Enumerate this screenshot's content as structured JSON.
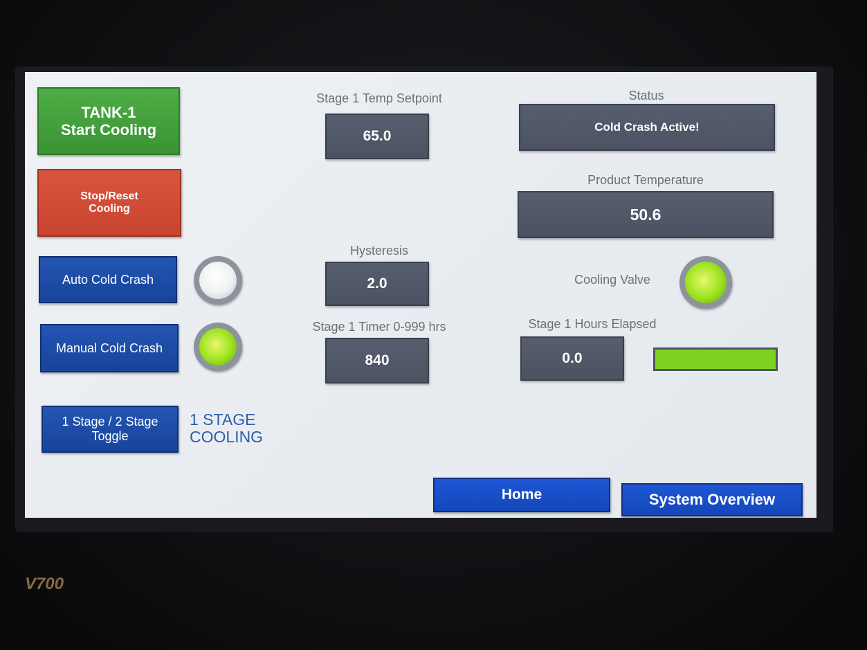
{
  "device": {
    "model": "V700"
  },
  "left_controls": {
    "start_button": "TANK-1\nStart Cooling",
    "stop_button": "Stop/Reset\nCooling",
    "auto_button": "Auto Cold Crash",
    "manual_button": "Manual Cold Crash",
    "stage_toggle_button": "1 Stage / 2 Stage\nToggle",
    "stage_mode_text": "1 STAGE\nCOOLING",
    "auto_indicator_state": "off",
    "manual_indicator_state": "on"
  },
  "setpoints": {
    "temp_setpoint_label": "Stage 1 Temp Setpoint",
    "temp_setpoint_value": "65.0",
    "hysteresis_label": "Hysteresis",
    "hysteresis_value": "2.0",
    "timer_label": "Stage 1 Timer 0-999 hrs",
    "timer_value": "840"
  },
  "status_panel": {
    "status_label": "Status",
    "status_value": "Cold Crash Active!",
    "product_temp_label": "Product Temperature",
    "product_temp_value": "50.6",
    "cooling_valve_label": "Cooling Valve",
    "cooling_valve_state": "on",
    "hours_elapsed_label": "Stage 1 Hours Elapsed",
    "hours_elapsed_value": "0.0",
    "progress_fill_fraction": 1.0
  },
  "navigation": {
    "home_button": "Home",
    "system_overview_button": "System Overview"
  },
  "colors": {
    "indicator_on": "#9be21f",
    "indicator_off": "#eef0f2",
    "progress_fill": "#7ed321"
  }
}
